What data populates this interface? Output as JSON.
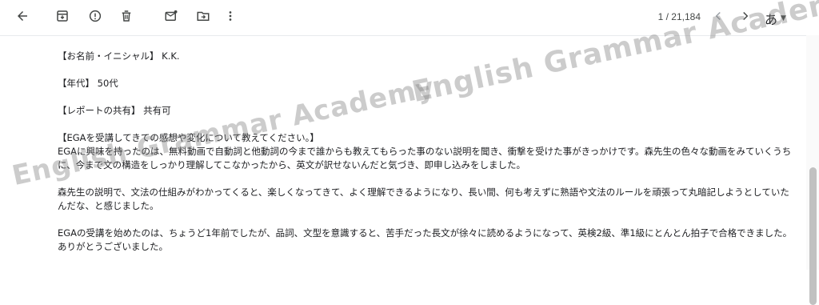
{
  "toolbar": {
    "back_icon": "arrow-left-icon",
    "archive_icon": "archive-icon",
    "spam_icon": "report-spam-icon",
    "delete_icon": "trash-icon",
    "mark_unread_icon": "mark-unread-icon",
    "move_icon": "move-to-icon",
    "more_icon": "more-vert-icon",
    "count": "1 / 21,184",
    "prev_icon": "chevron-left-icon",
    "next_icon": "chevron-right-icon",
    "input_tool": "あ"
  },
  "message": {
    "line1": "【お名前・イニシャル】 K.K.",
    "line2": "【年代】 50代",
    "line3": "【レポートの共有】 共有可",
    "question": "【EGAを受講してきての感想や変化について教えてください。】",
    "para1": "EGAに興味を持ったのは、無料動画で自動詞と他動詞の今まで誰からも教えてもらった事のない説明を聞き、衝撃を受けた事がきっかけです。森先生の色々な動画をみていくうちに、今まで文の構造をしっかり理解してこなかったから、英文が訳せないんだと気づき、即申し込みをしました。",
    "para2": "森先生の説明で、文法の仕組みがわかってくると、楽しくなってきて、よく理解できるようになり、長い間、何も考えずに熟語や文法のルールを頑張って丸暗記しようとしていたんだな、と感じました。",
    "para3": "EGAの受講を始めたのは、ちょうど1年前でしたが、品詞、文型を意識すると、苦手だった長文が徐々に読めるようになって、英検2級、準1級にとんとん拍子で合格できました。ありがとうございました。"
  },
  "watermark": {
    "text1": "English Grammar Academy",
    "text2": "English Grammar Academy"
  }
}
